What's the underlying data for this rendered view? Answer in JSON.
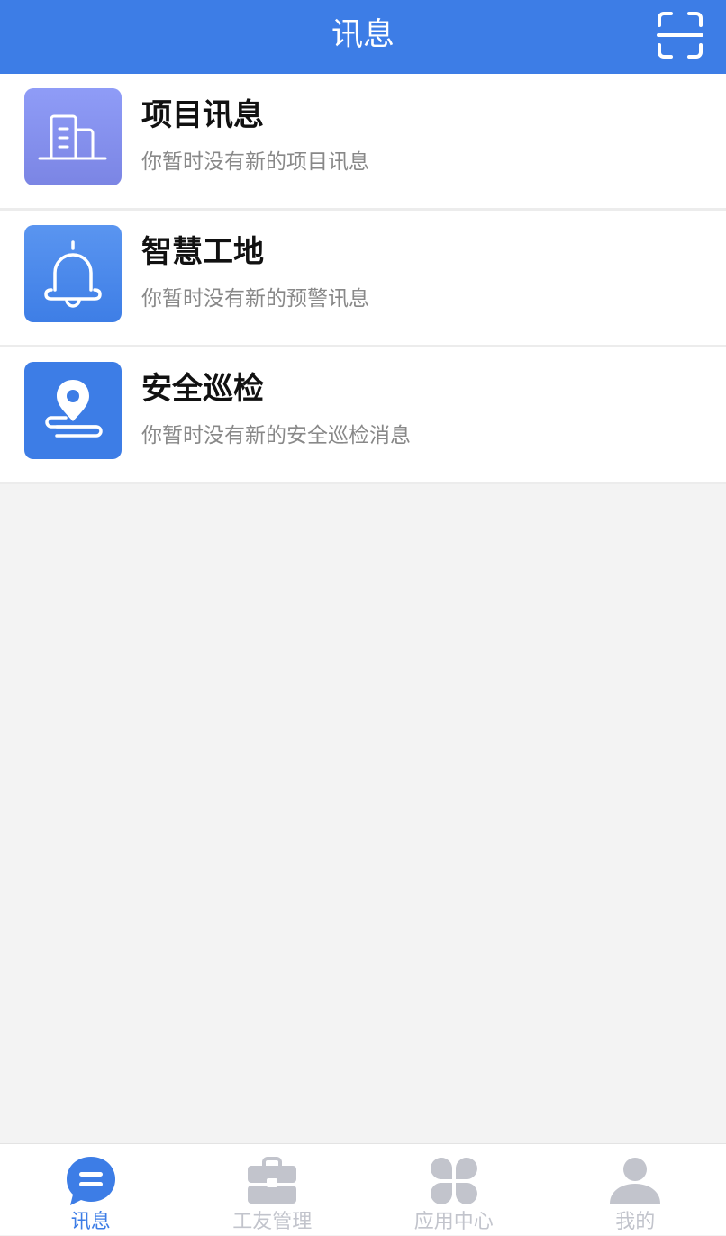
{
  "header": {
    "title": "讯息",
    "scan_icon": "scan-icon"
  },
  "messages": [
    {
      "title": "项目讯息",
      "desc": "你暂时没有新的项目讯息",
      "icon": "building-icon",
      "color": "#8590ee"
    },
    {
      "title": "智慧工地",
      "desc": "你暂时没有新的预警讯息",
      "icon": "bell-icon",
      "color": "#4a88ea"
    },
    {
      "title": "安全巡检",
      "desc": "你暂时没有新的安全巡检消息",
      "icon": "location-pin-icon",
      "color": "#3d7de6"
    }
  ],
  "tabbar": {
    "active_color": "#3d7de6",
    "inactive_color": "#c2c4cc",
    "tabs": [
      {
        "label": "讯息",
        "icon": "chat-icon",
        "active": true
      },
      {
        "label": "工友管理",
        "icon": "briefcase-icon",
        "active": false
      },
      {
        "label": "应用中心",
        "icon": "apps-grid-icon",
        "active": false
      },
      {
        "label": "我的",
        "icon": "user-icon",
        "active": false
      }
    ]
  }
}
